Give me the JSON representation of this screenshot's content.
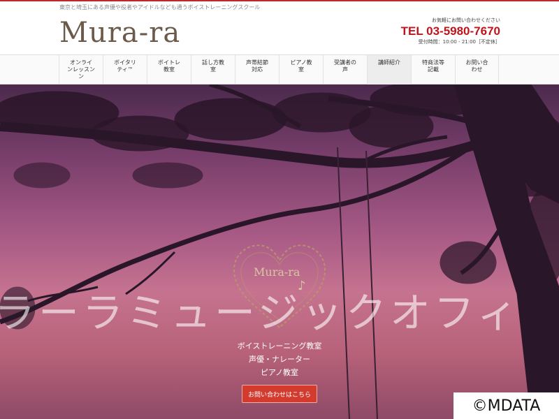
{
  "header": {
    "tagline": "東京と埼玉にある声優や役者やアイドルなども通うボイストレーニングスクール",
    "logo": "Mura-ra",
    "contact_note": "お気軽にお問い合わせください",
    "tel": "TEL 03-5980-7670",
    "hours": "受付時間：10:00 - 21:00［不定休］"
  },
  "nav": {
    "items": [
      {
        "label": "オンライ\nンレッスン\nン"
      },
      {
        "label": "ボイタリ\nティ™"
      },
      {
        "label": "ボイトレ\n教室"
      },
      {
        "label": "話し方教\n室"
      },
      {
        "label": "声帯結節\n対応"
      },
      {
        "label": "ピアノ教\n室"
      },
      {
        "label": "受講者の\n声"
      },
      {
        "label": "講師紹介"
      },
      {
        "label": "特商法等\n記載"
      },
      {
        "label": "お問い合\nわせ"
      }
    ]
  },
  "hero": {
    "emblem_text": "Mura-ra",
    "title": "ラーラミュージックオフィ",
    "subtitles": [
      "ボイストレーニング教室",
      "声優・ナレーター",
      "ピアノ教室"
    ],
    "cta_label": "お問い合わせはこちら"
  },
  "watermark": "©MDATA",
  "colors": {
    "accent": "#c0141c",
    "button": "#d23b2d",
    "logo": "#6b5a4a"
  }
}
